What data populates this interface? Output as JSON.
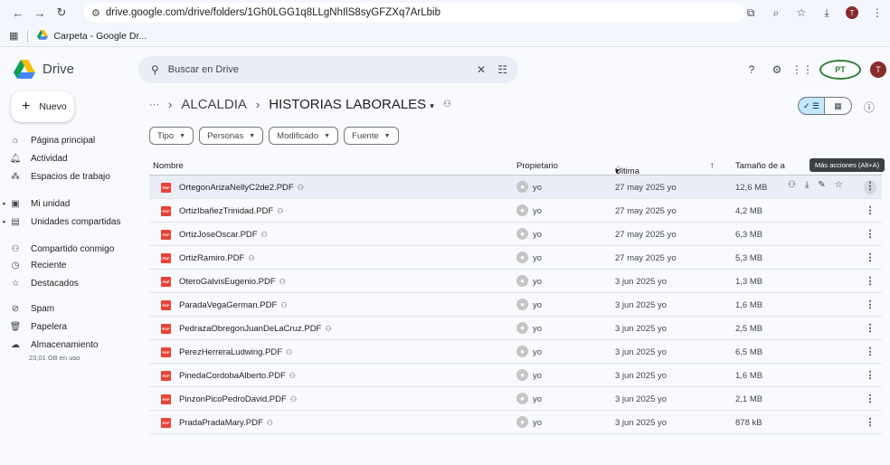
{
  "browser": {
    "url": "drive.google.com/drive/folders/1Gh0LGG1q8LLgNhIlS8syGFZXq7ArLbib",
    "bookmark": "Carpeta - Google Dr...",
    "profile_initial": "T"
  },
  "app": {
    "name": "Drive",
    "search_placeholder": "Buscar en Drive",
    "avatar_initial": "T",
    "org_logo_text": "PT"
  },
  "sidebar": {
    "new_label": "Nuevo",
    "items": [
      {
        "label": "Página principal",
        "icon": "home-icon"
      },
      {
        "label": "Actividad",
        "icon": "bell-icon"
      },
      {
        "label": "Espacios de trabajo",
        "icon": "workspaces-icon"
      },
      {
        "label": "Mi unidad",
        "icon": "my-drive-icon"
      },
      {
        "label": "Unidades compartidas",
        "icon": "shared-drives-icon"
      },
      {
        "label": "Compartido conmigo",
        "icon": "people-icon"
      },
      {
        "label": "Reciente",
        "icon": "clock-icon"
      },
      {
        "label": "Destacados",
        "icon": "star-icon"
      },
      {
        "label": "Spam",
        "icon": "spam-icon"
      },
      {
        "label": "Papelera",
        "icon": "trash-icon"
      },
      {
        "label": "Almacenamiento",
        "icon": "cloud-icon"
      }
    ],
    "storage_used": "23,01 GB en uso"
  },
  "breadcrumb": {
    "ellipsis": "···",
    "parent": "ALCALDIA",
    "current": "HISTORIAS LABORALES"
  },
  "filters": [
    "Tipo",
    "Personas",
    "Modificado",
    "Fuente"
  ],
  "table": {
    "headers": {
      "name": "Nombre",
      "owner": "Propietario",
      "modified": "Última modifica...",
      "size": "Tamaño de a"
    },
    "tooltip": "Más acciones (Alt+A)",
    "rows": [
      {
        "name": "OrtegonArizaNellyC2de2.PDF",
        "owner": "yo",
        "modified": "27 may 2025 yo",
        "size": "12,6 MB"
      },
      {
        "name": "OrtizIbañezTrinidad.PDF",
        "owner": "yo",
        "modified": "27 may 2025 yo",
        "size": "4,2 MB"
      },
      {
        "name": "OrtizJoseOscar.PDF",
        "owner": "yo",
        "modified": "27 may 2025 yo",
        "size": "6,3 MB"
      },
      {
        "name": "OrtizRamiro.PDF",
        "owner": "yo",
        "modified": "27 may 2025 yo",
        "size": "5,3 MB"
      },
      {
        "name": "OteroGalvisEugenio.PDF",
        "owner": "yo",
        "modified": "3 jun 2025 yo",
        "size": "1,3 MB"
      },
      {
        "name": "ParadaVegaGerman.PDF",
        "owner": "yo",
        "modified": "3 jun 2025 yo",
        "size": "1,6 MB"
      },
      {
        "name": "PedrazaObregonJuanDeLaCruz.PDF",
        "owner": "yo",
        "modified": "3 jun 2025 yo",
        "size": "2,5 MB"
      },
      {
        "name": "PerezHerreraLudwing.PDF",
        "owner": "yo",
        "modified": "3 jun 2025 yo",
        "size": "6,5 MB"
      },
      {
        "name": "PinedaCordobaAlberto.PDF",
        "owner": "yo",
        "modified": "3 jun 2025 yo",
        "size": "1,6 MB"
      },
      {
        "name": "PinzonPicoPedroDavid.PDF",
        "owner": "yo",
        "modified": "3 jun 2025 yo",
        "size": "2,1 MB"
      },
      {
        "name": "PradaPradaMary.PDF",
        "owner": "yo",
        "modified": "3 jun 2025 yo",
        "size": "878 kB"
      }
    ]
  }
}
